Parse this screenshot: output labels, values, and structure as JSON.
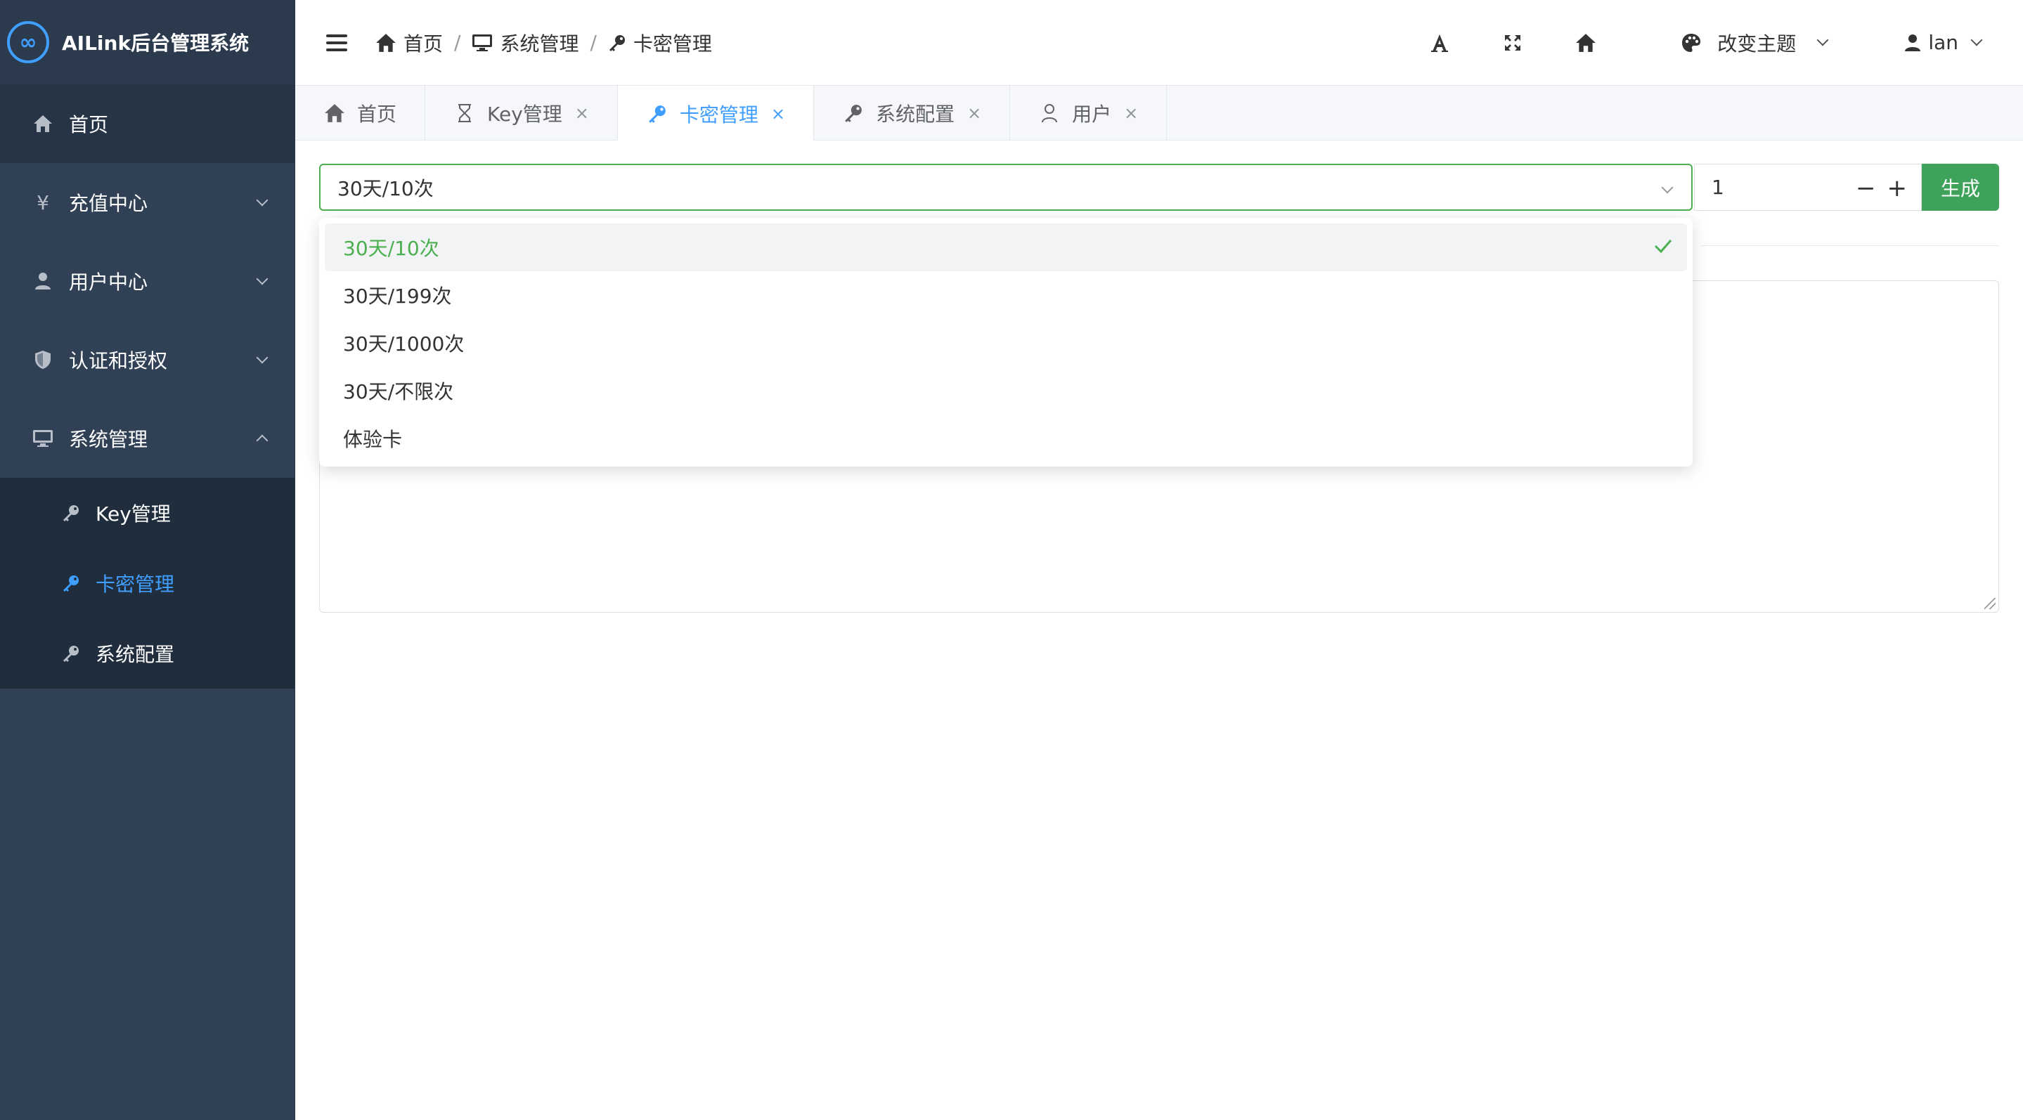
{
  "app": {
    "title": "AILink后台管理系统",
    "logo_mark": "∞"
  },
  "sidebar": {
    "items": [
      {
        "label": "首页",
        "icon": "home-icon"
      },
      {
        "label": "充值中心",
        "icon": "yen-icon",
        "glyph": "¥"
      },
      {
        "label": "用户中心",
        "icon": "user-icon"
      },
      {
        "label": "认证和授权",
        "icon": "shield-icon"
      },
      {
        "label": "系统管理",
        "icon": "monitor-icon"
      }
    ],
    "sub_items": [
      {
        "label": "Key管理",
        "icon": "key-icon"
      },
      {
        "label": "卡密管理",
        "icon": "key-icon"
      },
      {
        "label": "系统配置",
        "icon": "key-icon"
      }
    ]
  },
  "header": {
    "breadcrumb": [
      "首页",
      "系统管理",
      "卡密管理"
    ],
    "breadcrumb_sep": "/",
    "theme_label": "改变主题",
    "user_name": "lan"
  },
  "tabs": [
    {
      "label": "首页",
      "icon": "home-icon"
    },
    {
      "label": "Key管理",
      "icon": "hourglass-icon"
    },
    {
      "label": "卡密管理",
      "icon": "key-icon"
    },
    {
      "label": "系统配置",
      "icon": "key-icon"
    },
    {
      "label": "用户",
      "icon": "user-outline-icon"
    }
  ],
  "tab_close_glyph": "×",
  "form": {
    "selected_value": "30天/10次",
    "quantity": "1",
    "decrement": "−",
    "increment": "+",
    "generate_label": "生成"
  },
  "dropdown": {
    "options": [
      "30天/10次",
      "30天/199次",
      "30天/1000次",
      "30天/不限次",
      "体验卡"
    ],
    "selected_index": 0
  },
  "colors": {
    "sidebar_bg": "#304156",
    "accent": "#409eff",
    "success": "#4caf50",
    "button": "#3fa25b"
  }
}
